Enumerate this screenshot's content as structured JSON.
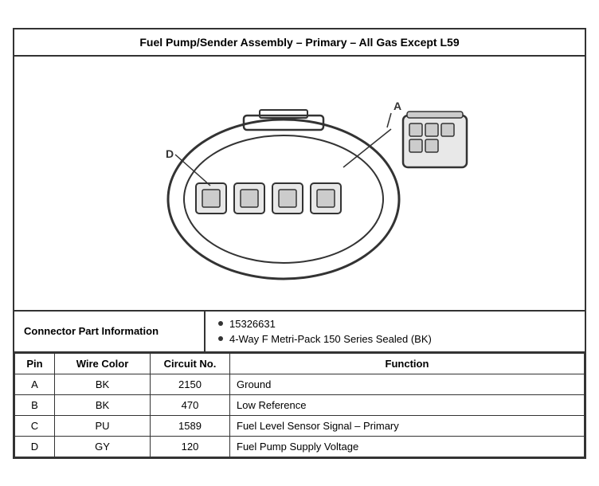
{
  "title": "Fuel Pump/Sender Assembly – Primary – All Gas Except L59",
  "diagram": {
    "label_d": "D",
    "label_a": "A"
  },
  "connector_info": {
    "label": "Connector Part Information",
    "bullets": [
      "15326631",
      "4-Way F Metri-Pack 150 Series Sealed (BK)"
    ]
  },
  "table": {
    "headers": [
      "Pin",
      "Wire Color",
      "Circuit No.",
      "Function"
    ],
    "rows": [
      {
        "pin": "A",
        "wire_color": "BK",
        "circuit_no": "2150",
        "function": "Ground"
      },
      {
        "pin": "B",
        "wire_color": "BK",
        "circuit_no": "470",
        "function": "Low Reference"
      },
      {
        "pin": "C",
        "wire_color": "PU",
        "circuit_no": "1589",
        "function": "Fuel Level Sensor Signal – Primary"
      },
      {
        "pin": "D",
        "wire_color": "GY",
        "circuit_no": "120",
        "function": "Fuel Pump Supply Voltage"
      }
    ]
  }
}
